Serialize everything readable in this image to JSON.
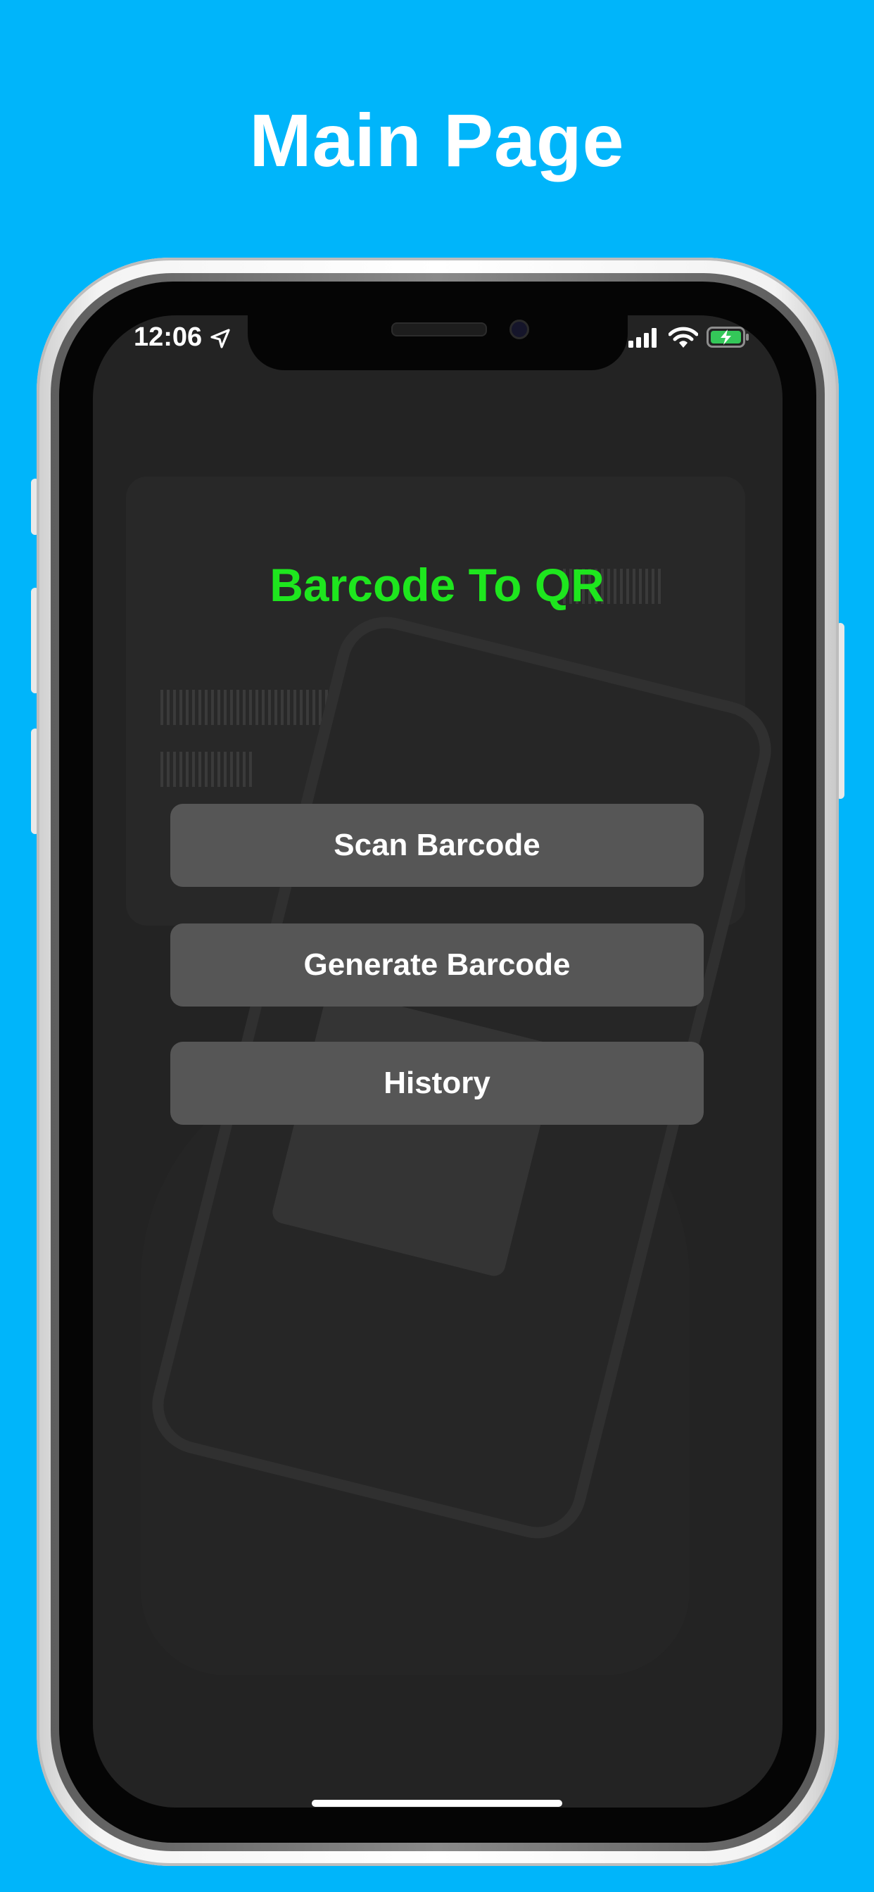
{
  "marketing": {
    "title": "Main Page"
  },
  "status_bar": {
    "time": "12:06",
    "icons": [
      "location-arrow-icon",
      "cellular-signal-icon",
      "wifi-icon",
      "battery-charging-icon"
    ]
  },
  "app": {
    "title": "Barcode To QR",
    "buttons": {
      "scan": "Scan Barcode",
      "generate": "Generate Barcode",
      "history": "History"
    }
  },
  "colors": {
    "page_background": "#00b5fa",
    "screen_background": "#232323",
    "title_accent": "#1ee61e",
    "button_background": "#565656",
    "battery_green": "#34c759"
  }
}
